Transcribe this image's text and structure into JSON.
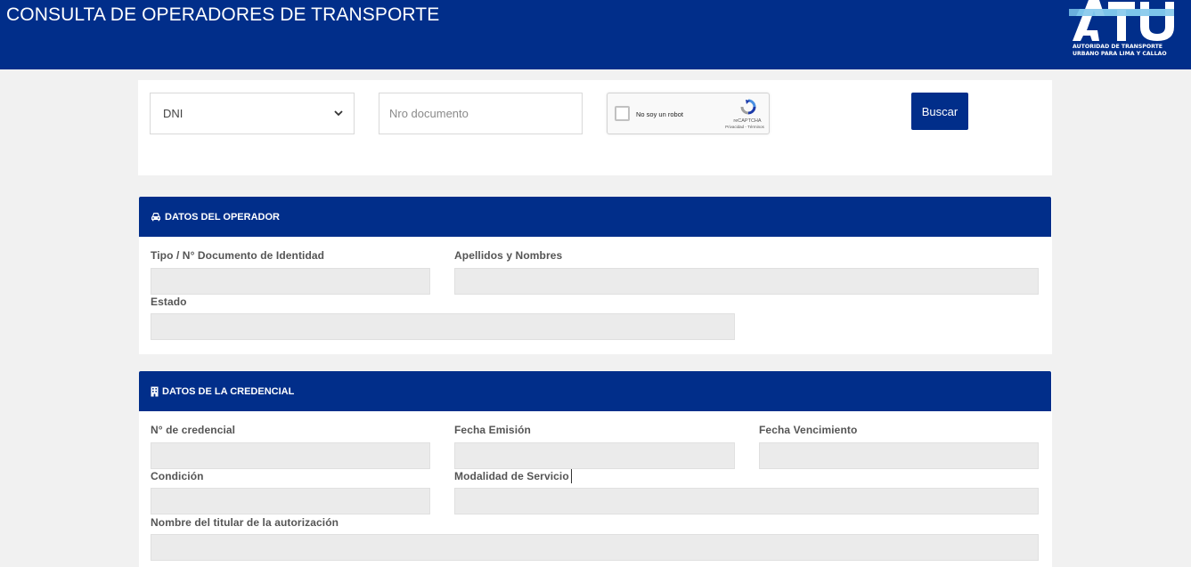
{
  "header": {
    "title": "CONSULTA DE OPERADORES DE TRANSPORTE",
    "logo_text": "ATU",
    "logo_line1": "AUTORIDAD DE TRANSPORTE",
    "logo_line2": "URBANO PARA LIMA Y CALLAO"
  },
  "search": {
    "doc_type_selected": "DNI",
    "doc_number_placeholder": "Nro documento",
    "captcha_label": "No soy un robot",
    "captcha_brand": "reCAPTCHA",
    "captcha_links": "Privacidad - Términos",
    "button_label": "Buscar"
  },
  "operador": {
    "heading": "DATOS DEL OPERADOR",
    "icon": "car-icon",
    "fields": {
      "tipo_documento": "Tipo / N° Documento de Identidad",
      "apellidos_nombres": "Apellidos y Nombres",
      "estado": "Estado"
    }
  },
  "credencial": {
    "heading": "DATOS DE LA CREDENCIAL",
    "icon": "building-icon",
    "fields": {
      "nro_credencial": "N° de credencial",
      "fecha_emision": "Fecha Emisión",
      "fecha_vencimiento": "Fecha Vencimiento",
      "condicion": "Condición",
      "modalidad": "Modalidad de Servicio",
      "titular": "Nombre del titular de la autorización"
    }
  },
  "colors": {
    "brand_blue": "#012e8a",
    "logo_light_blue": "#7cc4ea",
    "field_fill": "#ebebeb",
    "page_bg": "#f1f1f1"
  }
}
